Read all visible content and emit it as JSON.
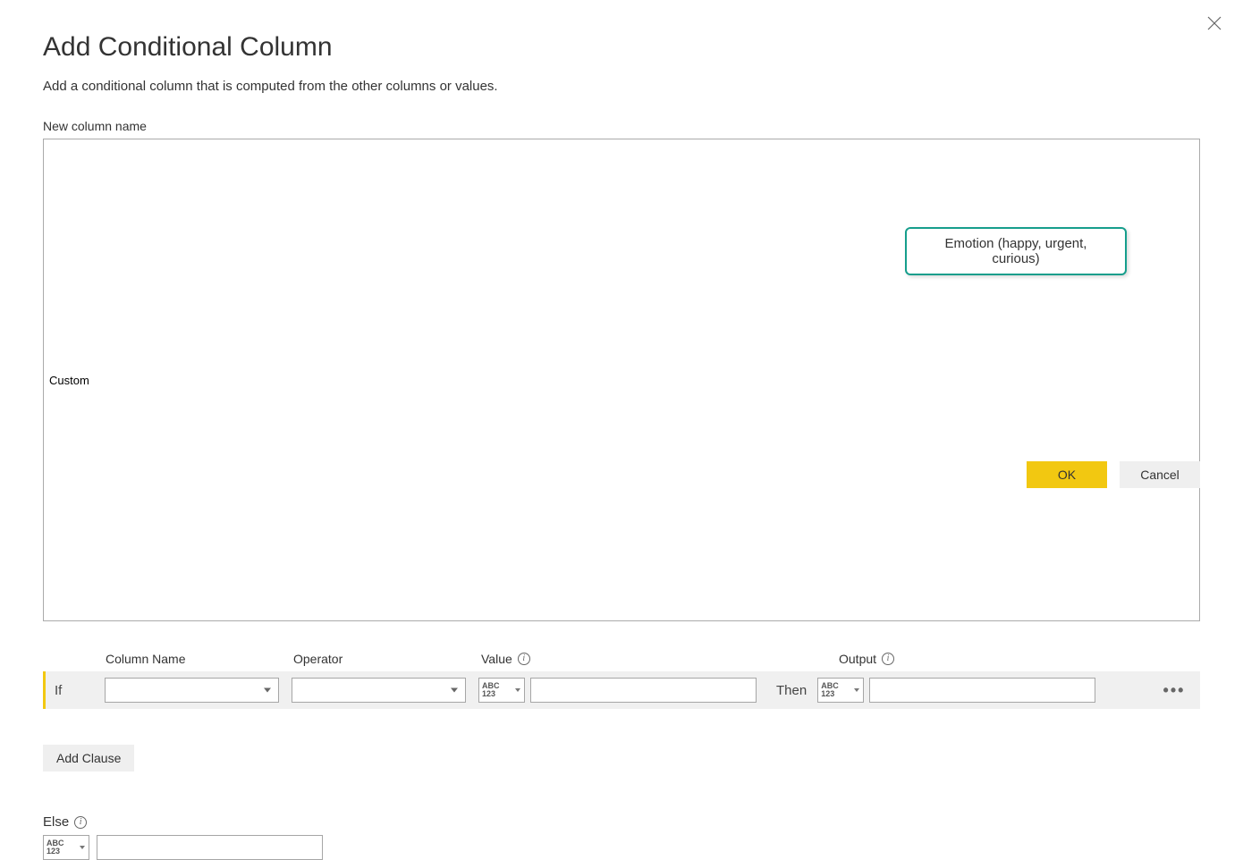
{
  "title": "Add Conditional Column",
  "subtitle": "Add a conditional column that is computed from the other columns or values.",
  "new_column": {
    "label": "New column name",
    "value": "Custom"
  },
  "headers": {
    "column_name": "Column Name",
    "operator": "Operator",
    "value": "Value",
    "output": "Output"
  },
  "clause": {
    "if_label": "If",
    "column_name": "",
    "operator": "",
    "value_type_glyph": "ABC\n123",
    "value": "",
    "then_label": "Then",
    "output_type_glyph": "ABC\n123",
    "output": ""
  },
  "callout": {
    "text": "Emotion (happy, urgent, curious)"
  },
  "add_clause_label": "Add Clause",
  "else": {
    "label": "Else",
    "type_glyph": "ABC\n123",
    "value": ""
  },
  "buttons": {
    "ok": "OK",
    "cancel": "Cancel"
  }
}
